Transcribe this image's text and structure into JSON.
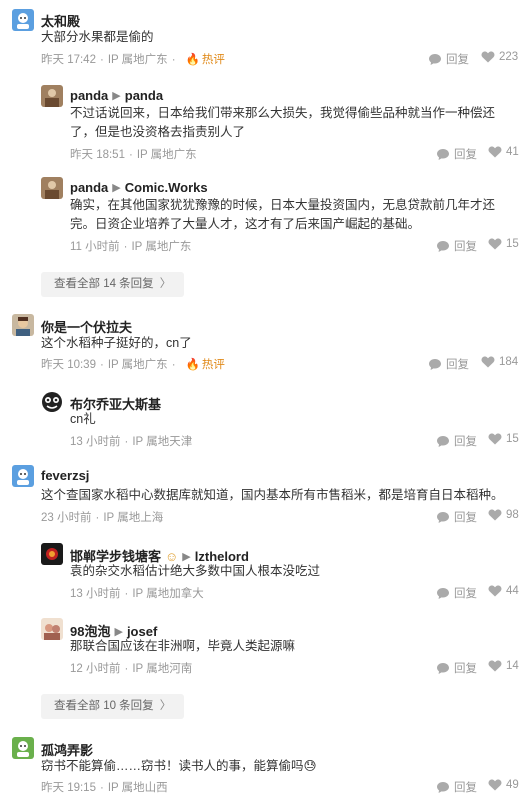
{
  "comments": [
    {
      "username": "太和殿",
      "text": "大部分水果都是偷的",
      "time": "昨天 17:42",
      "location": "IP 属地广东",
      "hot": "热评",
      "reply": "回复",
      "likes": "223",
      "replies": [
        {
          "username": "panda",
          "reply_to": "panda",
          "text": "不过话说回来，日本给我们带来那么大损失，我觉得偷些品种就当作一种偿还了，但是也没资格去指责别人了",
          "time": "昨天 18:51",
          "location": "IP 属地广东",
          "reply": "回复",
          "likes": "41"
        },
        {
          "username": "panda",
          "reply_to": "Comic.Works",
          "text": "确实，在其他国家犹犹豫豫的时候，日本大量投资国内，无息贷款前几年才还完。日资企业培养了大量人才，这才有了后来国产崛起的基础。",
          "time": "11 小时前",
          "location": "IP 属地广东",
          "reply": "回复",
          "likes": "15"
        }
      ],
      "more": "查看全部 14 条回复"
    },
    {
      "username": "你是一个伏拉夫",
      "text": "这个水稻种子挺好的，cn了",
      "time": "昨天 10:39",
      "location": "IP 属地广东",
      "hot": "热评",
      "reply": "回复",
      "likes": "184",
      "replies": [
        {
          "username": "布尔乔亚大斯基",
          "text": "cn礼",
          "time": "13 小时前",
          "location": "IP 属地天津",
          "reply": "回复",
          "likes": "15"
        }
      ]
    },
    {
      "username": "feverzsj",
      "text": "这个查国家水稻中心数据库就知道，国内基本所有市售稻米，都是培育自日本稻种。",
      "time": "23 小时前",
      "location": "IP 属地上海",
      "reply": "回复",
      "likes": "98",
      "replies": [
        {
          "username": "邯郸学步钱塘客",
          "reply_to": "lzthelord",
          "text": "袁的杂交水稻估计绝大多数中国人根本没吃过",
          "time": "13 小时前",
          "location": "IP 属地加拿大",
          "reply": "回复",
          "likes": "44"
        },
        {
          "username": "98泡泡",
          "reply_to": "josef",
          "text": "那联合国应该在非洲啊，毕竟人类起源嘛",
          "time": "12 小时前",
          "location": "IP 属地河南",
          "reply": "回复",
          "likes": "14"
        }
      ],
      "more": "查看全部 10 条回复"
    },
    {
      "username": "孤鸿弄影",
      "text": "窃书不能算偷……窃书！读书人的事，能算偷吗😓",
      "time": "昨天 19:15",
      "location": "IP 属地山西",
      "reply": "回复",
      "likes": "49"
    }
  ],
  "colors": {
    "hot": "#e08a1a",
    "meta": "#999999",
    "more_bg": "#f2f2f2"
  },
  "icons": {
    "reply": "chat-bubble-icon",
    "like": "heart-icon",
    "hot": "flame-icon"
  }
}
